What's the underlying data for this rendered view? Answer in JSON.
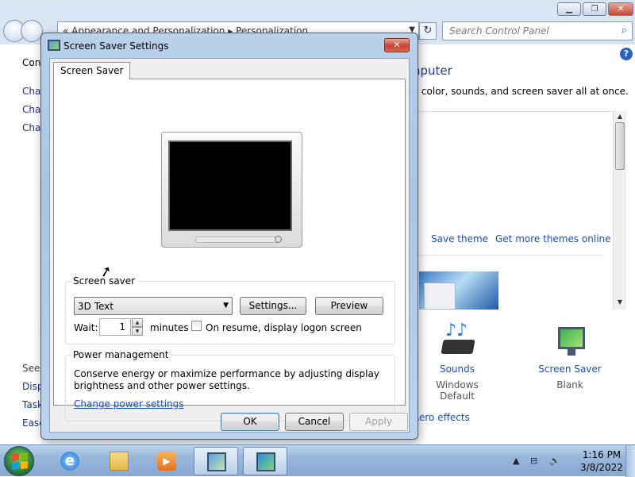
{
  "control_panel": {
    "breadcrumb": [
      "Appearance and Personalization",
      "Personalization"
    ],
    "breadcrumb_prefix": "«",
    "breadcrumb_sep": "▸",
    "search_placeholder": "Search Control Panel",
    "nav_partial": [
      "Con",
      "Cha",
      "Cha",
      "Cha"
    ],
    "heading_partial": "nputer",
    "description_partial": "v color, sounds, and screen saver all at once.",
    "save_theme": "Save theme",
    "get_more_themes": "Get more themes online",
    "sounds_label": "Sounds",
    "sounds_value": "Windows Default",
    "screensaver_label": "Screen Saver",
    "screensaver_value": "Blank",
    "aero_partial": "Aero effects",
    "see_also_partial": "See",
    "see_also_items": [
      "Disp",
      "Task",
      "Ease"
    ]
  },
  "dialog": {
    "title": "Screen Saver Settings",
    "close_glyph": "✕",
    "tab_label": "Screen Saver",
    "screen_saver_group": "Screen saver",
    "selected_saver": "3D Text",
    "settings_button": "Settings...",
    "preview_button": "Preview",
    "wait_label": "Wait:",
    "wait_value": "1",
    "minutes_label": "minutes",
    "on_resume_label": "On resume, display logon screen",
    "on_resume_checked": false,
    "power_group": "Power management",
    "power_text": "Conserve energy or maximize performance by adjusting display brightness and other power settings.",
    "power_link": "Change power settings",
    "ok_button": "OK",
    "cancel_button": "Cancel",
    "apply_button": "Apply"
  },
  "taskbar": {
    "time": "1:16 PM",
    "date": "3/8/2022",
    "media_glyph": "▶"
  },
  "glyphs": {
    "back": "←",
    "forward": "→",
    "dropdown": "▼",
    "refresh": "↻",
    "search": "⌕",
    "minimize": "▁",
    "maximize": "❐",
    "close": "✕",
    "help": "?",
    "scroll_up": "▲",
    "scroll_down": "▼",
    "spin_up": "▲",
    "spin_down": "▼",
    "ie": "e",
    "tray_arrow": "▲",
    "tray_network": "⊟",
    "tray_sound": "🔈",
    "cursor": "➚"
  },
  "colors": {
    "link": "#1e4fa5",
    "dialog_frame": "#b9d1ea",
    "taskbar": "#97b6db"
  }
}
